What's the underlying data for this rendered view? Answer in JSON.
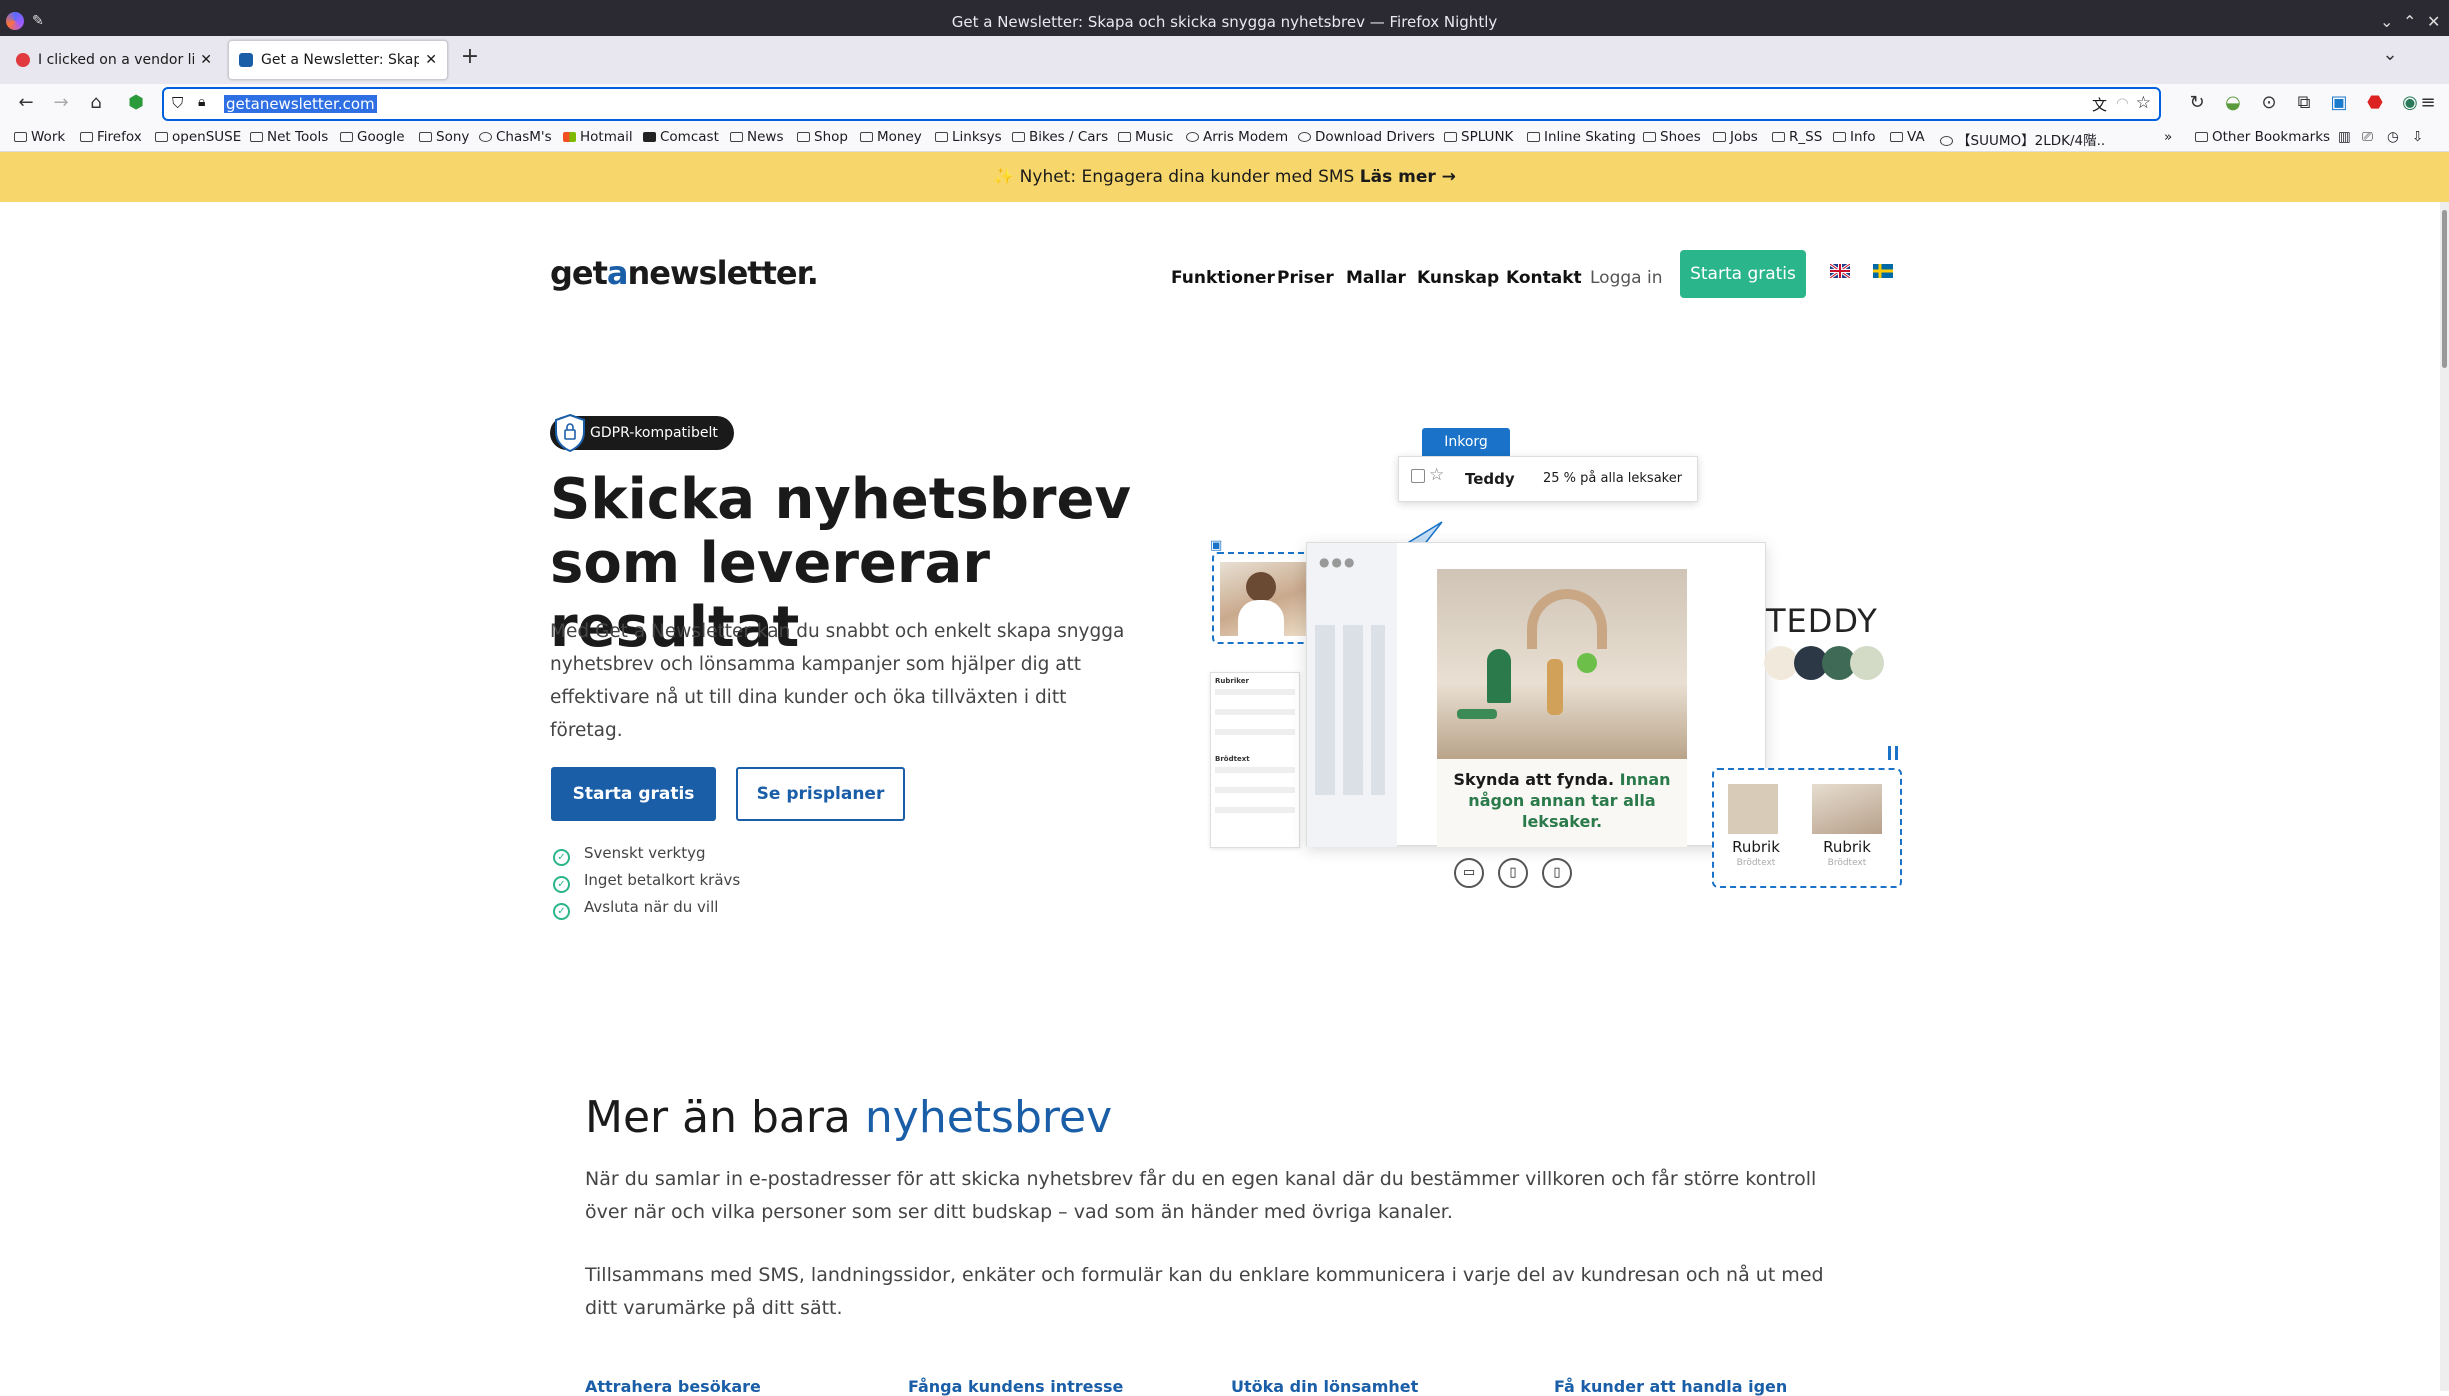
{
  "window": {
    "title": "Get a Newsletter: Skapa och skicka snygga nyhetsbrev — Firefox Nightly"
  },
  "tabs": [
    {
      "label": "I clicked on a vendor link w"
    },
    {
      "label": "Get a Newsletter: Skapa oc"
    }
  ],
  "addressbar": {
    "url": "getanewsletter.com"
  },
  "bookmarks": [
    "Work",
    "Firefox",
    "openSUSE",
    "Net Tools",
    "Google",
    "Sony",
    "ChasM's",
    "Hotmail",
    "Comcast",
    "News",
    "Shop",
    "Money",
    "Linksys",
    "Bikes / Cars",
    "Music",
    "Arris Modem",
    "Download Drivers",
    "SPLUNK",
    "Inline Skating",
    "Shoes",
    "Jobs",
    "R_SS",
    "Info",
    "VA",
    "【SUUMO】2LDK/4階...",
    "Other Bookmarks"
  ],
  "banner": {
    "text": "Nyhet: Engagera dina kunder med SMS",
    "link": "Läs mer →"
  },
  "site": {
    "logo_pre": "get",
    "logo_a": "a",
    "logo_post": "newsletter.",
    "nav": [
      "Funktioner",
      "Priser",
      "Mallar",
      "Kunskap",
      "Kontakt"
    ],
    "login": "Logga in",
    "cta_top": "Starta gratis",
    "gdpr": "GDPR-kompatibelt",
    "h1_line1": "Skicka nyhetsbrev",
    "h1_line2": "som levererar resultat",
    "lead": "Med Get a Newsletter kan du snabbt och enkelt skapa snygga nyhetsbrev och lönsamma kampanjer som hjälper dig att effektivare nå ut till dina kunder och öka tillväxten i ditt företag.",
    "btn_primary": "Starta gratis",
    "btn_secondary": "Se prisplaner",
    "checks": [
      "Svenskt verktyg",
      "Inget betalkort krävs",
      "Avsluta när du vill"
    ],
    "illus": {
      "inbox": "Inkorg",
      "sender": "Teddy",
      "subject": "25 % på alla leksaker",
      "brand": "TEDDY",
      "cta_a": "Skynda att fynda.",
      "cta_b": "Innan någon annan tar alla leksaker.",
      "rubrik": "Rubrik",
      "brodtext": "Brödtext",
      "side1": "Rubriker",
      "side2": "Brödtext"
    },
    "section_title_a": "Mer än bara",
    "section_title_b": "nyhetsbrev",
    "para1": "När du samlar in e-postadresser för att skicka nyhetsbrev får du en egen kanal där du bestämmer villkoren och får större kontroll över när och vilka personer som ser ditt budskap – vad som än händer med övriga kanaler.",
    "para2": "Tillsammans med SMS, landningssidor, enkäter och formulär kan du enklare kommunicera i varje del av kundresan och nå ut med ditt varumärke på ditt sätt.",
    "features": [
      "Attrahera besökare",
      "Fånga kundens intresse",
      "Utöka din lönsamhet",
      "Få kunder att handla igen"
    ]
  },
  "colors": {
    "brand_blue": "#1a5ea8",
    "brand_green": "#2bb58a",
    "banner": "#f7d76c"
  }
}
